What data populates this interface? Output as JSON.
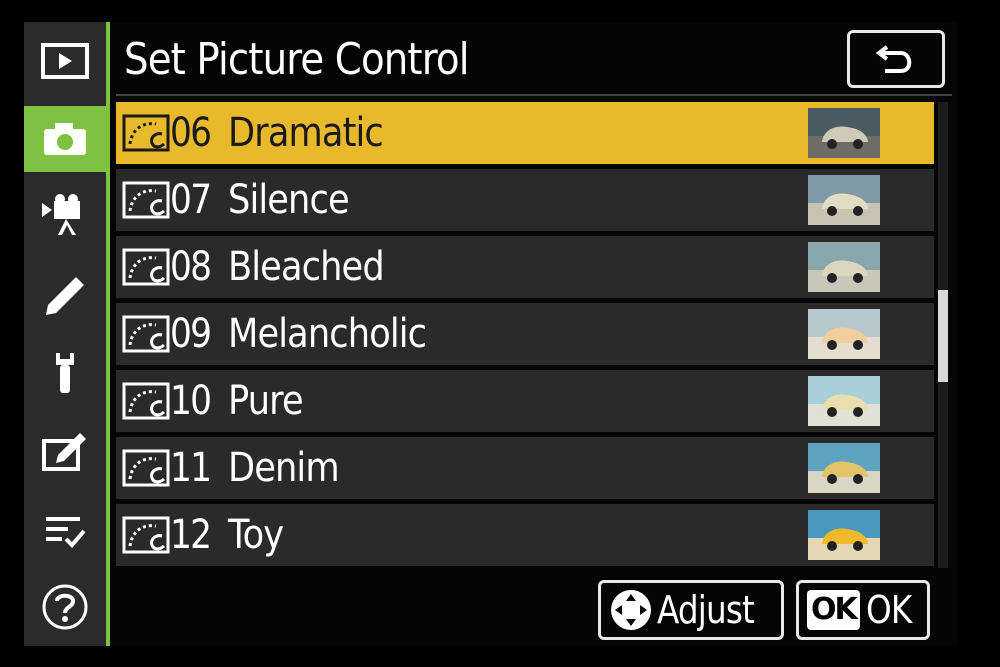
{
  "header": {
    "title": "Set Picture Control"
  },
  "list": {
    "items": [
      {
        "num": "06",
        "name": "Dramatic",
        "selected": true
      },
      {
        "num": "07",
        "name": "Silence",
        "selected": false
      },
      {
        "num": "08",
        "name": "Bleached",
        "selected": false
      },
      {
        "num": "09",
        "name": "Melancholic",
        "selected": false
      },
      {
        "num": "10",
        "name": "Pure",
        "selected": false
      },
      {
        "num": "11",
        "name": "Denim",
        "selected": false
      },
      {
        "num": "12",
        "name": "Toy",
        "selected": false
      }
    ]
  },
  "footer": {
    "adjust_label": "Adjust",
    "ok_badge": "OK",
    "ok_label": "OK"
  },
  "sidebar": {
    "tabs": [
      {
        "icon": "playback-icon"
      },
      {
        "icon": "camera-icon",
        "active": true
      },
      {
        "icon": "movie-icon"
      },
      {
        "icon": "pencil-icon"
      },
      {
        "icon": "wrench-icon"
      },
      {
        "icon": "retouch-icon"
      },
      {
        "icon": "my-menu-icon"
      },
      {
        "icon": "help-icon"
      }
    ]
  },
  "colors": {
    "accent": "#7fc241",
    "highlight": "#e8b92a",
    "row": "#2a2a2a"
  }
}
